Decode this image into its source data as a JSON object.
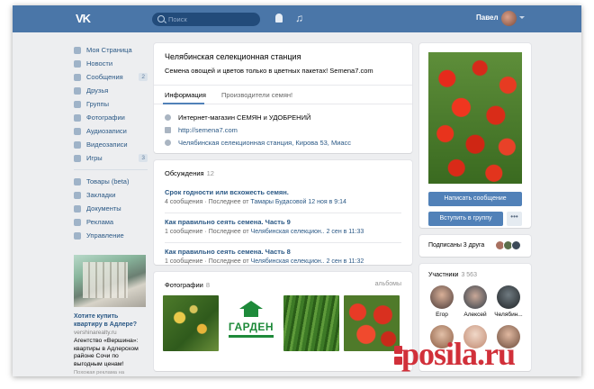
{
  "topbar": {
    "search_placeholder": "Поиск",
    "user_name": "Павел"
  },
  "sidebar": {
    "items": [
      {
        "label": "Моя Страница",
        "icon": "home-icon"
      },
      {
        "label": "Новости",
        "icon": "news-icon"
      },
      {
        "label": "Сообщения",
        "icon": "messages-icon",
        "badge": "2"
      },
      {
        "label": "Друзья",
        "icon": "friends-icon"
      },
      {
        "label": "Группы",
        "icon": "groups-icon"
      },
      {
        "label": "Фотографии",
        "icon": "photo-icon"
      },
      {
        "label": "Аудиозаписи",
        "icon": "audio-icon"
      },
      {
        "label": "Видеозаписи",
        "icon": "video-icon"
      },
      {
        "label": "Игры",
        "icon": "games-icon",
        "badge": "3"
      }
    ],
    "items2": [
      {
        "label": "Товары (beta)",
        "icon": "goods-icon"
      },
      {
        "label": "Закладки",
        "icon": "bookmark-icon"
      },
      {
        "label": "Документы",
        "icon": "documents-icon"
      },
      {
        "label": "Реклама",
        "icon": "ads-icon"
      },
      {
        "label": "Управление",
        "icon": "manage-icon"
      }
    ],
    "ad": {
      "title": "Хотите купить квартиру в Адлере?",
      "domain": "vershinarealty.ru",
      "text": "Агентство «Вершина»: квартиры в Адлерском районе Сочи по выгодным ценам!",
      "note": "Похожая реклама на"
    }
  },
  "group": {
    "title": "Челябинская селекционная станция",
    "status": "Семена овощей и цветов только в цветных пакетах! Semena7.com",
    "tabs": [
      "Информация",
      "Производители семян!"
    ],
    "info": [
      {
        "icon": "info-icon",
        "text": "Интернет-магазин СЕМЯН и УДОБРЕНИЙ",
        "link": false
      },
      {
        "icon": "flag-icon",
        "text": "http://semena7.com",
        "link": true
      },
      {
        "icon": "location-icon",
        "text": "Челябинская селекционная станция, Кирова 53, Миасс",
        "link": true
      }
    ]
  },
  "discussions": {
    "title": "Обсуждения",
    "count": "12",
    "topics": [
      {
        "title": "Срок годности или всхожесть семян.",
        "count": "4 сообщения",
        "last_prefix": "Последнее от",
        "author": "Тамары Будасовой",
        "date": "12 ноя в 9:14"
      },
      {
        "title": "Как правильно сеять семена. Часть 9",
        "count": "1 сообщение",
        "last_prefix": "Последнее от",
        "author": "Челябинская селекцион..",
        "date": "2 сен в 11:33"
      },
      {
        "title": "Как правильно сеять семена. Часть 8",
        "count": "1 сообщение",
        "last_prefix": "Последнее от",
        "author": "Челябинская селекцион..",
        "date": "2 сен в 11:32"
      }
    ]
  },
  "photos": {
    "title": "Фотографии",
    "count": "8",
    "albums": "альбомы",
    "logo_text": "ГАРДЕН"
  },
  "right": {
    "write_button": "Написать сообщение",
    "join_button": "Вступить в группу",
    "more": "•••",
    "friends_text": "Подписаны 3 друга",
    "members_title": "Участники",
    "members_count": "3 563",
    "members": [
      {
        "name": "Егор"
      },
      {
        "name": "Алексей"
      },
      {
        "name": "Челябин..."
      }
    ]
  },
  "watermark": "posila.ru",
  "colors": {
    "header": "#4a76a8",
    "link": "#2a5885",
    "button": "#5181b8",
    "watermark": "#d1303a"
  }
}
